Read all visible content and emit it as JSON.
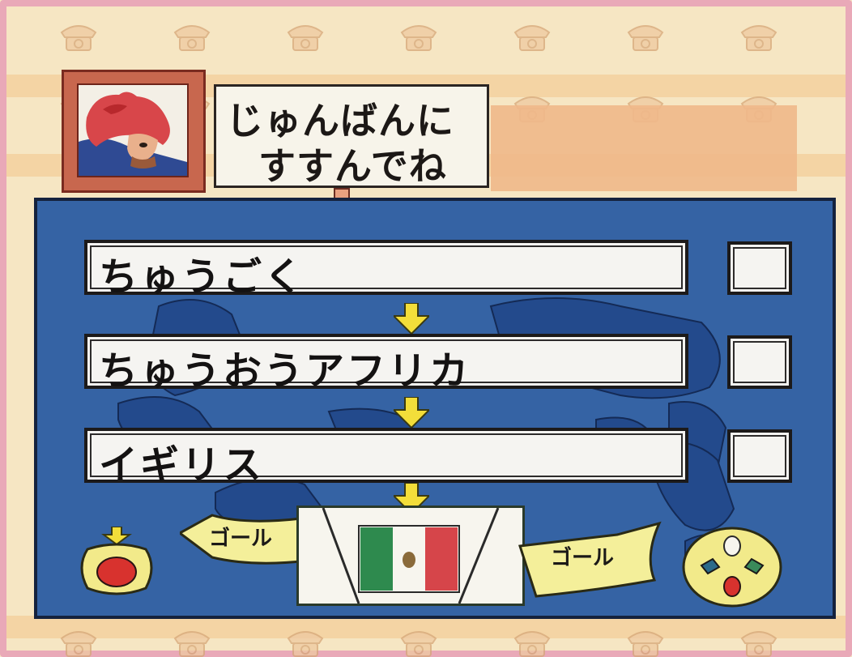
{
  "message": {
    "line1": "じゅんばんに",
    "line2": "すすんでね"
  },
  "route": [
    {
      "label": "ちゅうごく",
      "checked": false
    },
    {
      "label": "ちゅうおうアフリカ",
      "checked": false
    },
    {
      "label": "イギリス",
      "checked": false
    }
  ],
  "goal": {
    "left_ribbon": "ゴール",
    "right_ribbon": "ゴール",
    "flag": "mexico-flag"
  },
  "colors": {
    "map_ocean": "#3563a4",
    "map_land": "#234a8c",
    "arrow": "#f3de3a",
    "background": "#f6e6c3",
    "frame_pink": "#e9a9b8"
  },
  "icons": {
    "left_button": "red-button-icon",
    "right_button": "controller-pad-icon"
  }
}
